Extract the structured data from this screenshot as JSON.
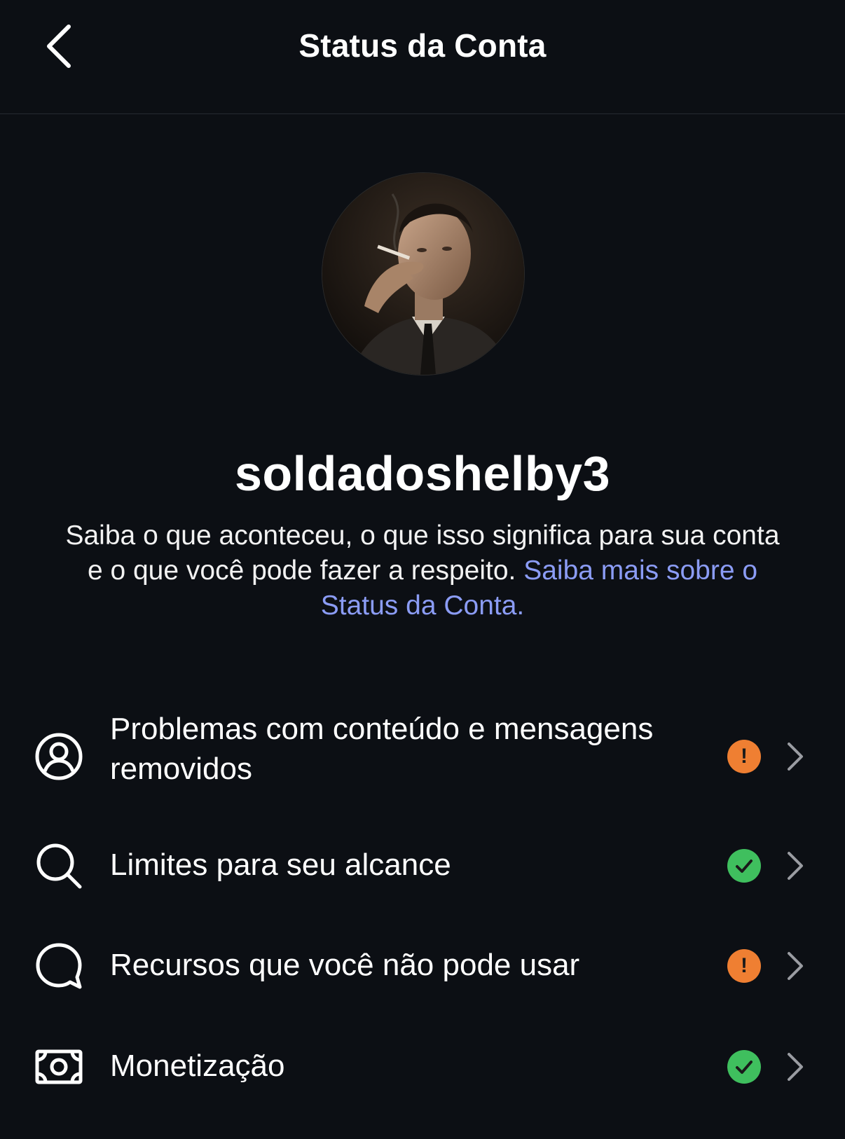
{
  "header": {
    "title": "Status da Conta",
    "back_icon": "chevron-left-icon"
  },
  "profile": {
    "username": "soldadoshelby3",
    "description": "Saiba o que aconteceu, o que isso significa para sua conta e o que você pode fazer a respeito.",
    "learn_more_link": "Saiba mais sobre o Status da Conta."
  },
  "items": [
    {
      "label": "Problemas com conteúdo e mensagens removidos",
      "icon": "user-circle-icon",
      "status": "warning"
    },
    {
      "label": "Limites para seu alcance",
      "icon": "search-icon",
      "status": "ok"
    },
    {
      "label": "Recursos que você não pode usar",
      "icon": "chat-bubble-icon",
      "status": "warning"
    },
    {
      "label": "Monetização",
      "icon": "money-icon",
      "status": "ok"
    }
  ],
  "colors": {
    "background": "#0c0f14",
    "link": "#8b9cf5",
    "warning": "#ef7f32",
    "ok": "#3fbf5e"
  }
}
